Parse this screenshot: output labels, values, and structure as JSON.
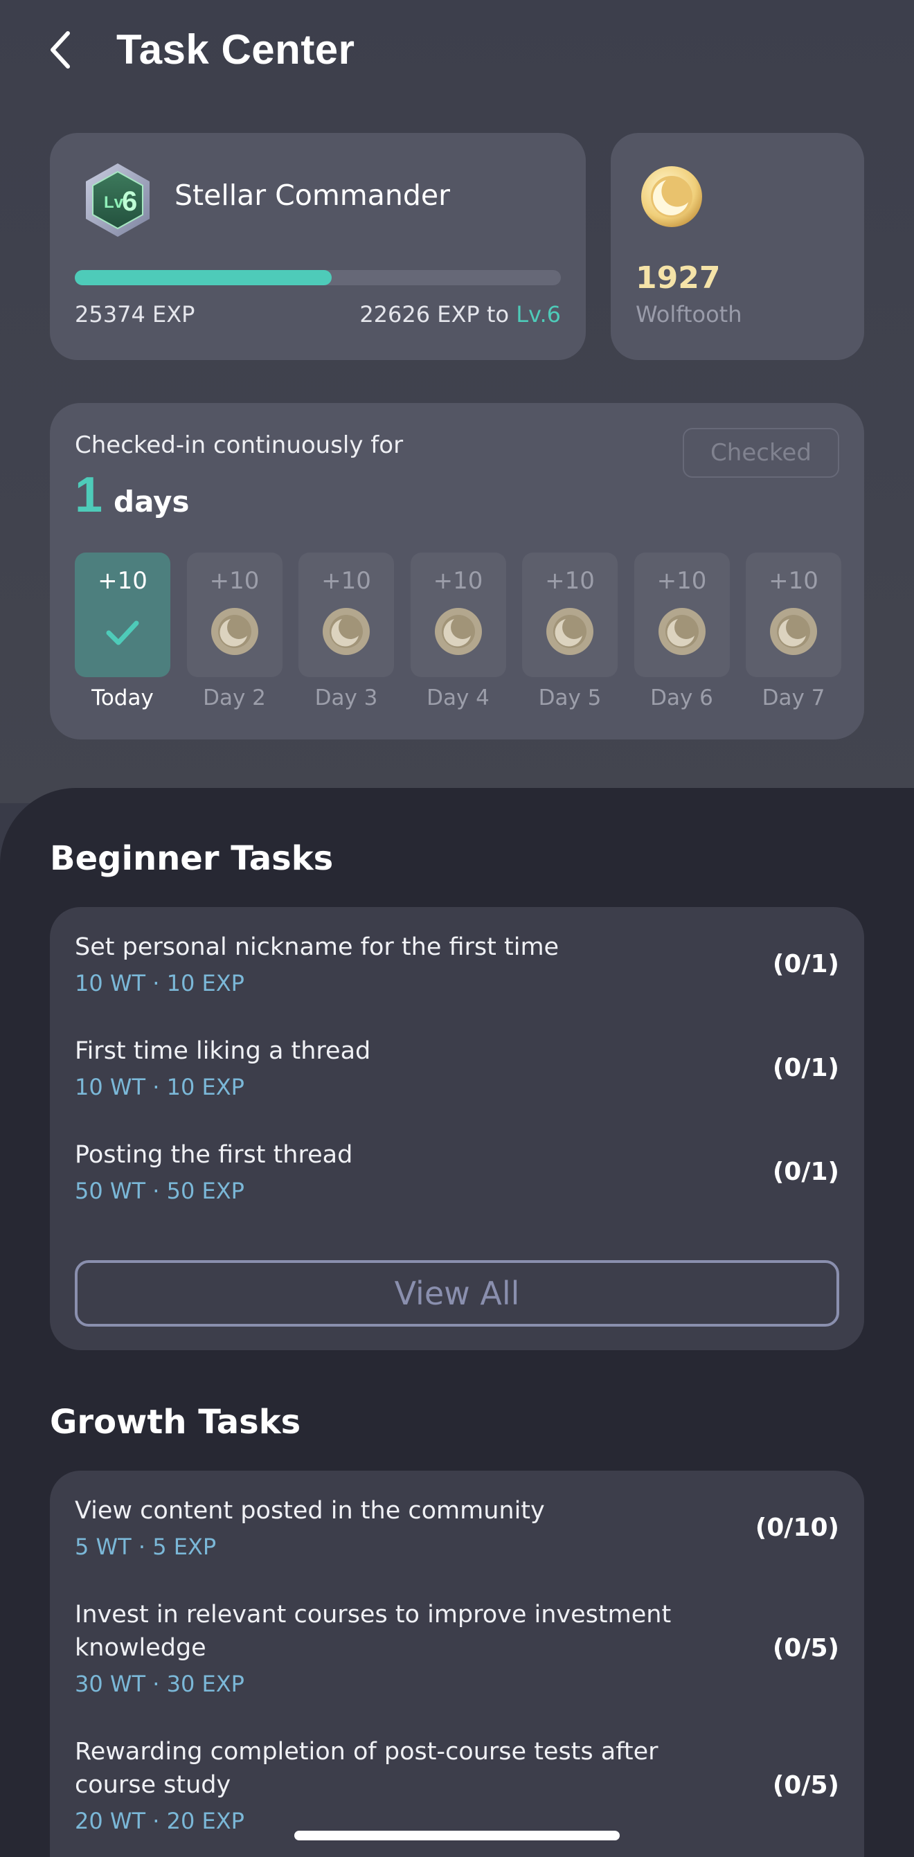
{
  "header": {
    "title": "Task Center"
  },
  "level": {
    "name": "Stellar Commander",
    "badge_text": "Lv",
    "badge_number": "6",
    "exp_current": "25374 EXP",
    "exp_next_prefix": "22626 EXP to ",
    "exp_next_level": "Lv.6",
    "progress_fraction": 0.528
  },
  "coins": {
    "amount": "1927",
    "label": "Wolftooth"
  },
  "checkin": {
    "text": "Checked-in continuously for",
    "streak_number": "1",
    "streak_unit": "days",
    "button_label": "Checked",
    "days": [
      {
        "reward": "+10",
        "label": "Today",
        "checked": true
      },
      {
        "reward": "+10",
        "label": "Day 2",
        "checked": false
      },
      {
        "reward": "+10",
        "label": "Day 3",
        "checked": false
      },
      {
        "reward": "+10",
        "label": "Day 4",
        "checked": false
      },
      {
        "reward": "+10",
        "label": "Day 5",
        "checked": false
      },
      {
        "reward": "+10",
        "label": "Day 6",
        "checked": false
      },
      {
        "reward": "+10",
        "label": "Day 7",
        "checked": false
      }
    ]
  },
  "beginner": {
    "title": "Beginner Tasks",
    "tasks": [
      {
        "title": "Set personal nickname for the first time",
        "reward": "10 WT · 10 EXP",
        "progress": "(0/1)"
      },
      {
        "title": "First time liking a thread",
        "reward": "10 WT · 10 EXP",
        "progress": "(0/1)"
      },
      {
        "title": "Posting the first thread",
        "reward": "50 WT · 50 EXP",
        "progress": "(0/1)"
      }
    ],
    "view_all": "View All"
  },
  "growth": {
    "title": "Growth Tasks",
    "tasks": [
      {
        "title": "View content posted in the community",
        "reward": "5 WT · 5 EXP",
        "progress": "(0/10)"
      },
      {
        "title": "Invest in relevant courses to improve investment knowledge",
        "reward": "30 WT · 30 EXP",
        "progress": "(0/5)"
      },
      {
        "title": "Rewarding completion of post-course tests after course study",
        "reward": "20 WT · 20 EXP",
        "progress": "(0/5)"
      }
    ]
  },
  "colors": {
    "accent": "#4ecbb9",
    "coin": "#f5e3a8",
    "reward_text": "#7bb8d8"
  }
}
